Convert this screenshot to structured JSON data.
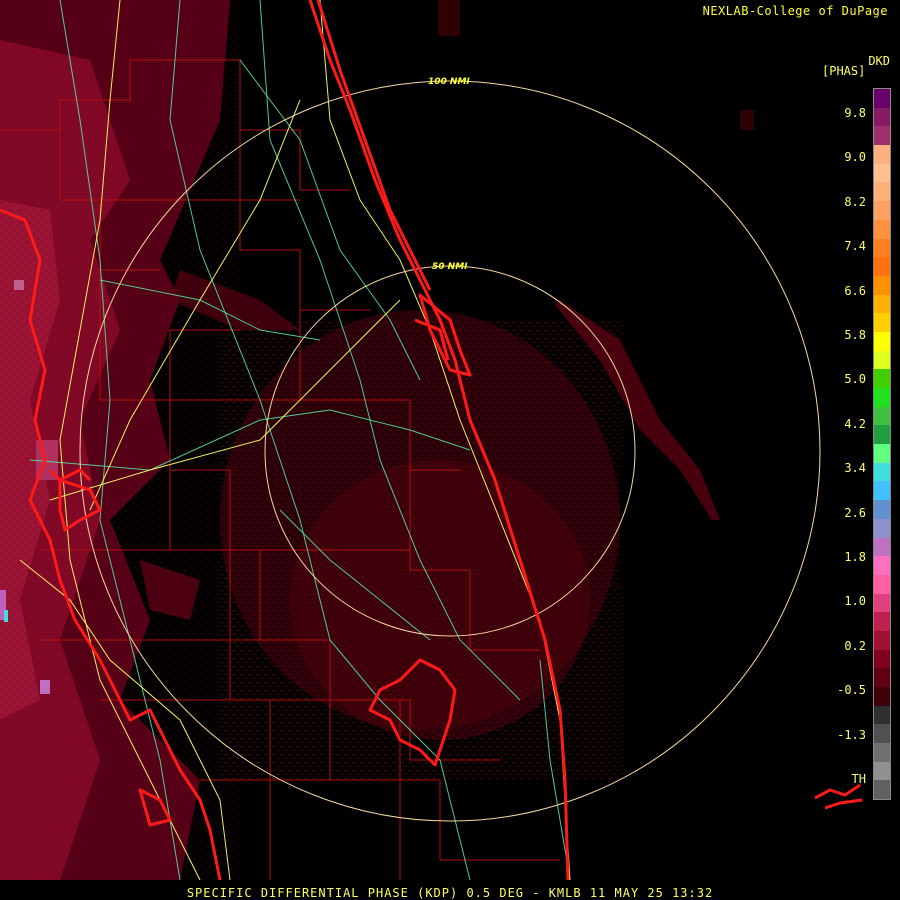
{
  "header": {
    "credit": "NEXLAB-College of DuPage"
  },
  "legend": {
    "product_code": "DKD",
    "units": "[PHAS]",
    "labels": [
      "9.8",
      "9.0",
      "8.2",
      "7.4",
      "6.6",
      "5.8",
      "5.0",
      "4.2",
      "3.4",
      "2.6",
      "1.8",
      "1.0",
      "0.2",
      "-0.5",
      "-1.3",
      "TH"
    ],
    "colors": [
      "#6a006a",
      "#881a66",
      "#a0306a",
      "#ffb080",
      "#ffc090",
      "#ffb078",
      "#ffa060",
      "#ff9040",
      "#ff8020",
      "#ff7010",
      "#ff9000",
      "#ffb000",
      "#ffd000",
      "#ffff00",
      "#e0ff20",
      "#40d000",
      "#20e020",
      "#40c040",
      "#20a040",
      "#60ff80",
      "#40e0e0",
      "#40c0ff",
      "#6090d0",
      "#9090d0",
      "#c070c0",
      "#ff70c0",
      "#ff60a0",
      "#e04080",
      "#c02050",
      "#a01030",
      "#800020",
      "#600010",
      "#400008",
      "#303030",
      "#505050",
      "#707070",
      "#909090",
      "#606060"
    ]
  },
  "map": {
    "range_rings": [
      {
        "label": "50 NMI"
      },
      {
        "label": "100 NMI"
      }
    ],
    "colors": {
      "coastline": "#ff1a1a",
      "county_lines": "#cc1010",
      "highways": "#ffff66",
      "roads": "#66ffaa",
      "range_ring": "#ffdd99",
      "echo_dark": "#5a0010",
      "echo_mid": "#8a0020",
      "echo_light": "#c02050"
    }
  },
  "status": {
    "text": "SPECIFIC DIFFERENTIAL PHASE (KDP) 0.5 DEG - KMLB 11 MAY 25 13:32"
  }
}
